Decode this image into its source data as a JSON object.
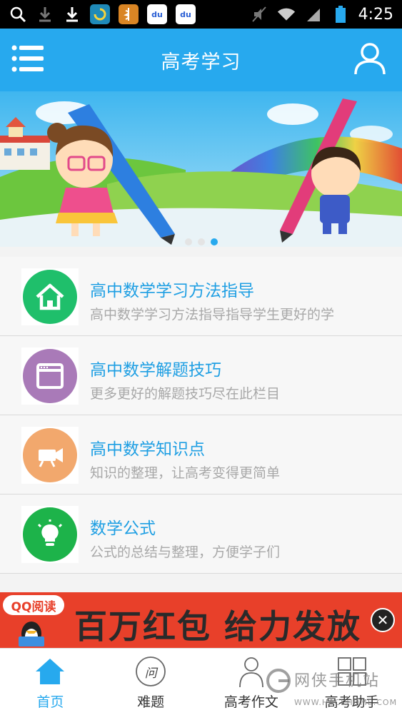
{
  "status_bar": {
    "time": "4:25",
    "app_icons": [
      "search-icon",
      "download-icon",
      "download-icon",
      "app-icon",
      "app-icon",
      "baidu-icon",
      "baidu-icon"
    ],
    "app_labels": [
      "du",
      "du"
    ]
  },
  "header": {
    "title": "高考学习"
  },
  "banner": {
    "active_index": 2,
    "page_count": 3
  },
  "menu_items": [
    {
      "title": "高中数学学习方法指导",
      "desc": "高中数学学习方法指导指导学生更好的学",
      "icon": "home-icon",
      "color": "#1fbf6b"
    },
    {
      "title": "高中数学解题技巧",
      "desc": "更多更好的解题技巧尽在此栏目",
      "icon": "window-icon",
      "color": "#a97ab8"
    },
    {
      "title": "高中数学知识点",
      "desc": "知识的整理，让高考变得更简单",
      "icon": "video-camera-icon",
      "color": "#f2a86d"
    },
    {
      "title": "数学公式",
      "desc": "公式的总结与整理，方便学子们",
      "icon": "lightbulb-icon",
      "color": "#1db34a"
    }
  ],
  "ad": {
    "brand": "QQ阅读",
    "headline": "百万红包 给力发放"
  },
  "tabs": [
    {
      "label": "首页",
      "icon": "home-icon",
      "active": true
    },
    {
      "label": "难题",
      "icon": "question-icon",
      "glyph": "问",
      "active": false
    },
    {
      "label": "高考作文",
      "icon": "person-icon",
      "active": false
    },
    {
      "label": "高考助手",
      "icon": "grid-icon",
      "active": false
    }
  ],
  "watermark": {
    "text": "网侠手机站",
    "url": "WWW.HACKHOME.COM"
  },
  "colors": {
    "accent": "#27a9ee",
    "ad_background": "#e8402a"
  }
}
